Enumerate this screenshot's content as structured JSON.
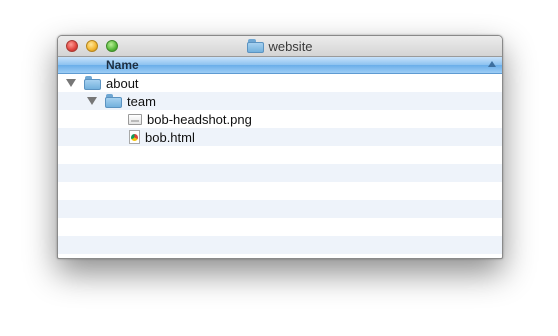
{
  "window": {
    "title": "website"
  },
  "header": {
    "column_name": "Name"
  },
  "tree": [
    {
      "label": "about",
      "type": "folder",
      "expanded": true
    },
    {
      "label": "team",
      "type": "folder",
      "expanded": true
    },
    {
      "label": "bob-headshot.png",
      "type": "image-file"
    },
    {
      "label": "bob.html",
      "type": "html-file"
    }
  ],
  "colors": {
    "header_blue": "#8cc2f0",
    "row_stripe": "#eef3fa",
    "folder_blue": "#73b1dd"
  }
}
